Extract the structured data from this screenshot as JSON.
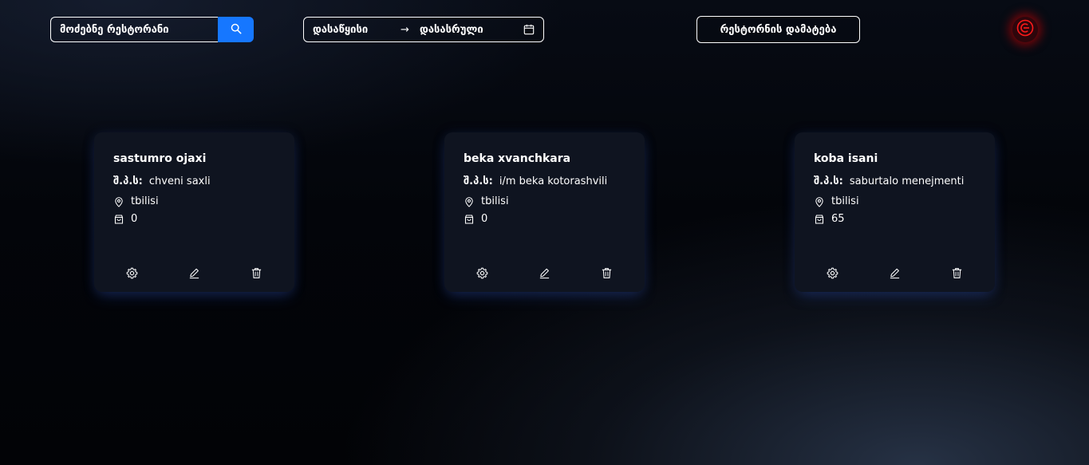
{
  "header": {
    "search": {
      "placeholder": "მოძებნე რესტორანი",
      "icon": "search-icon"
    },
    "date_range": {
      "start_placeholder": "დასაწყისი",
      "arrow": "→",
      "end_placeholder": "დასასრული",
      "icon": "calendar-icon"
    },
    "add_button_label": "რესტორნის დამატება",
    "logout_icon": "logout-icon"
  },
  "restaurants": [
    {
      "name": "sastumro ojaxi",
      "company_label": "შ.პ.ს:",
      "company": "chveni saxli",
      "city": "tbilisi",
      "count": "0"
    },
    {
      "name": "beka xvanchkara",
      "company_label": "შ.პ.ს:",
      "company": "i/m beka kotorashvili",
      "city": "tbilisi",
      "count": "0"
    },
    {
      "name": "koba isani",
      "company_label": "შ.პ.ს:",
      "company": "saburtalo menejmenti",
      "city": "tbilisi",
      "count": "65"
    }
  ],
  "colors": {
    "accent": "#1677ff",
    "logout": "#e01010",
    "card_bg": "#0f1420"
  }
}
